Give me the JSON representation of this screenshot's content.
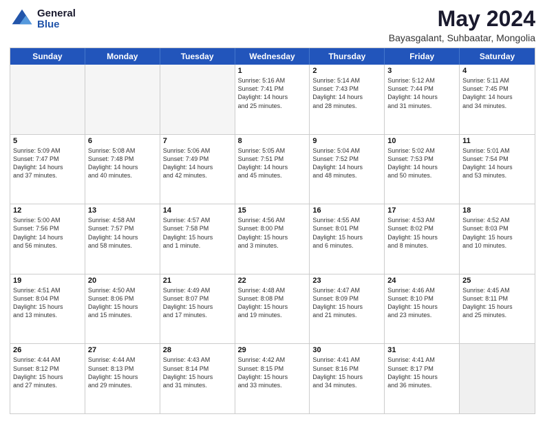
{
  "logo": {
    "general": "General",
    "blue": "Blue"
  },
  "header": {
    "month": "May 2024",
    "location": "Bayasgalant, Suhbaatar, Mongolia"
  },
  "weekdays": [
    "Sunday",
    "Monday",
    "Tuesday",
    "Wednesday",
    "Thursday",
    "Friday",
    "Saturday"
  ],
  "weeks": [
    [
      {
        "day": "",
        "info": ""
      },
      {
        "day": "",
        "info": ""
      },
      {
        "day": "",
        "info": ""
      },
      {
        "day": "1",
        "info": "Sunrise: 5:16 AM\nSunset: 7:41 PM\nDaylight: 14 hours\nand 25 minutes."
      },
      {
        "day": "2",
        "info": "Sunrise: 5:14 AM\nSunset: 7:43 PM\nDaylight: 14 hours\nand 28 minutes."
      },
      {
        "day": "3",
        "info": "Sunrise: 5:12 AM\nSunset: 7:44 PM\nDaylight: 14 hours\nand 31 minutes."
      },
      {
        "day": "4",
        "info": "Sunrise: 5:11 AM\nSunset: 7:45 PM\nDaylight: 14 hours\nand 34 minutes."
      }
    ],
    [
      {
        "day": "5",
        "info": "Sunrise: 5:09 AM\nSunset: 7:47 PM\nDaylight: 14 hours\nand 37 minutes."
      },
      {
        "day": "6",
        "info": "Sunrise: 5:08 AM\nSunset: 7:48 PM\nDaylight: 14 hours\nand 40 minutes."
      },
      {
        "day": "7",
        "info": "Sunrise: 5:06 AM\nSunset: 7:49 PM\nDaylight: 14 hours\nand 42 minutes."
      },
      {
        "day": "8",
        "info": "Sunrise: 5:05 AM\nSunset: 7:51 PM\nDaylight: 14 hours\nand 45 minutes."
      },
      {
        "day": "9",
        "info": "Sunrise: 5:04 AM\nSunset: 7:52 PM\nDaylight: 14 hours\nand 48 minutes."
      },
      {
        "day": "10",
        "info": "Sunrise: 5:02 AM\nSunset: 7:53 PM\nDaylight: 14 hours\nand 50 minutes."
      },
      {
        "day": "11",
        "info": "Sunrise: 5:01 AM\nSunset: 7:54 PM\nDaylight: 14 hours\nand 53 minutes."
      }
    ],
    [
      {
        "day": "12",
        "info": "Sunrise: 5:00 AM\nSunset: 7:56 PM\nDaylight: 14 hours\nand 56 minutes."
      },
      {
        "day": "13",
        "info": "Sunrise: 4:58 AM\nSunset: 7:57 PM\nDaylight: 14 hours\nand 58 minutes."
      },
      {
        "day": "14",
        "info": "Sunrise: 4:57 AM\nSunset: 7:58 PM\nDaylight: 15 hours\nand 1 minute."
      },
      {
        "day": "15",
        "info": "Sunrise: 4:56 AM\nSunset: 8:00 PM\nDaylight: 15 hours\nand 3 minutes."
      },
      {
        "day": "16",
        "info": "Sunrise: 4:55 AM\nSunset: 8:01 PM\nDaylight: 15 hours\nand 6 minutes."
      },
      {
        "day": "17",
        "info": "Sunrise: 4:53 AM\nSunset: 8:02 PM\nDaylight: 15 hours\nand 8 minutes."
      },
      {
        "day": "18",
        "info": "Sunrise: 4:52 AM\nSunset: 8:03 PM\nDaylight: 15 hours\nand 10 minutes."
      }
    ],
    [
      {
        "day": "19",
        "info": "Sunrise: 4:51 AM\nSunset: 8:04 PM\nDaylight: 15 hours\nand 13 minutes."
      },
      {
        "day": "20",
        "info": "Sunrise: 4:50 AM\nSunset: 8:06 PM\nDaylight: 15 hours\nand 15 minutes."
      },
      {
        "day": "21",
        "info": "Sunrise: 4:49 AM\nSunset: 8:07 PM\nDaylight: 15 hours\nand 17 minutes."
      },
      {
        "day": "22",
        "info": "Sunrise: 4:48 AM\nSunset: 8:08 PM\nDaylight: 15 hours\nand 19 minutes."
      },
      {
        "day": "23",
        "info": "Sunrise: 4:47 AM\nSunset: 8:09 PM\nDaylight: 15 hours\nand 21 minutes."
      },
      {
        "day": "24",
        "info": "Sunrise: 4:46 AM\nSunset: 8:10 PM\nDaylight: 15 hours\nand 23 minutes."
      },
      {
        "day": "25",
        "info": "Sunrise: 4:45 AM\nSunset: 8:11 PM\nDaylight: 15 hours\nand 25 minutes."
      }
    ],
    [
      {
        "day": "26",
        "info": "Sunrise: 4:44 AM\nSunset: 8:12 PM\nDaylight: 15 hours\nand 27 minutes."
      },
      {
        "day": "27",
        "info": "Sunrise: 4:44 AM\nSunset: 8:13 PM\nDaylight: 15 hours\nand 29 minutes."
      },
      {
        "day": "28",
        "info": "Sunrise: 4:43 AM\nSunset: 8:14 PM\nDaylight: 15 hours\nand 31 minutes."
      },
      {
        "day": "29",
        "info": "Sunrise: 4:42 AM\nSunset: 8:15 PM\nDaylight: 15 hours\nand 33 minutes."
      },
      {
        "day": "30",
        "info": "Sunrise: 4:41 AM\nSunset: 8:16 PM\nDaylight: 15 hours\nand 34 minutes."
      },
      {
        "day": "31",
        "info": "Sunrise: 4:41 AM\nSunset: 8:17 PM\nDaylight: 15 hours\nand 36 minutes."
      },
      {
        "day": "",
        "info": ""
      }
    ]
  ]
}
